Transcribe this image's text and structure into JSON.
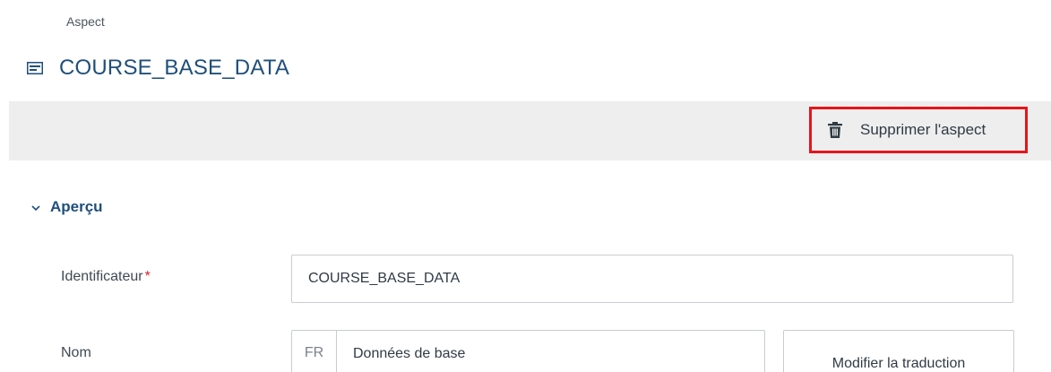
{
  "breadcrumb": "Aspect",
  "header": {
    "title": "COURSE_BASE_DATA",
    "icon": "aspect-card-icon"
  },
  "toolbar": {
    "delete_label": "Supprimer l'aspect",
    "delete_icon": "trash-icon",
    "highlight_color": "#e8141b"
  },
  "section": {
    "label": "Aperçu",
    "expanded": true
  },
  "form": {
    "identifier": {
      "label": "Identificateur",
      "required_mark": "*",
      "value": "COURSE_BASE_DATA"
    },
    "name": {
      "label": "Nom",
      "lang": "FR",
      "value": "Données de base",
      "translate_label": "Modifier la traduction"
    }
  },
  "colors": {
    "title": "#1f4f7a",
    "toolbar_bg": "#eeeeee",
    "required": "#d8202c"
  }
}
